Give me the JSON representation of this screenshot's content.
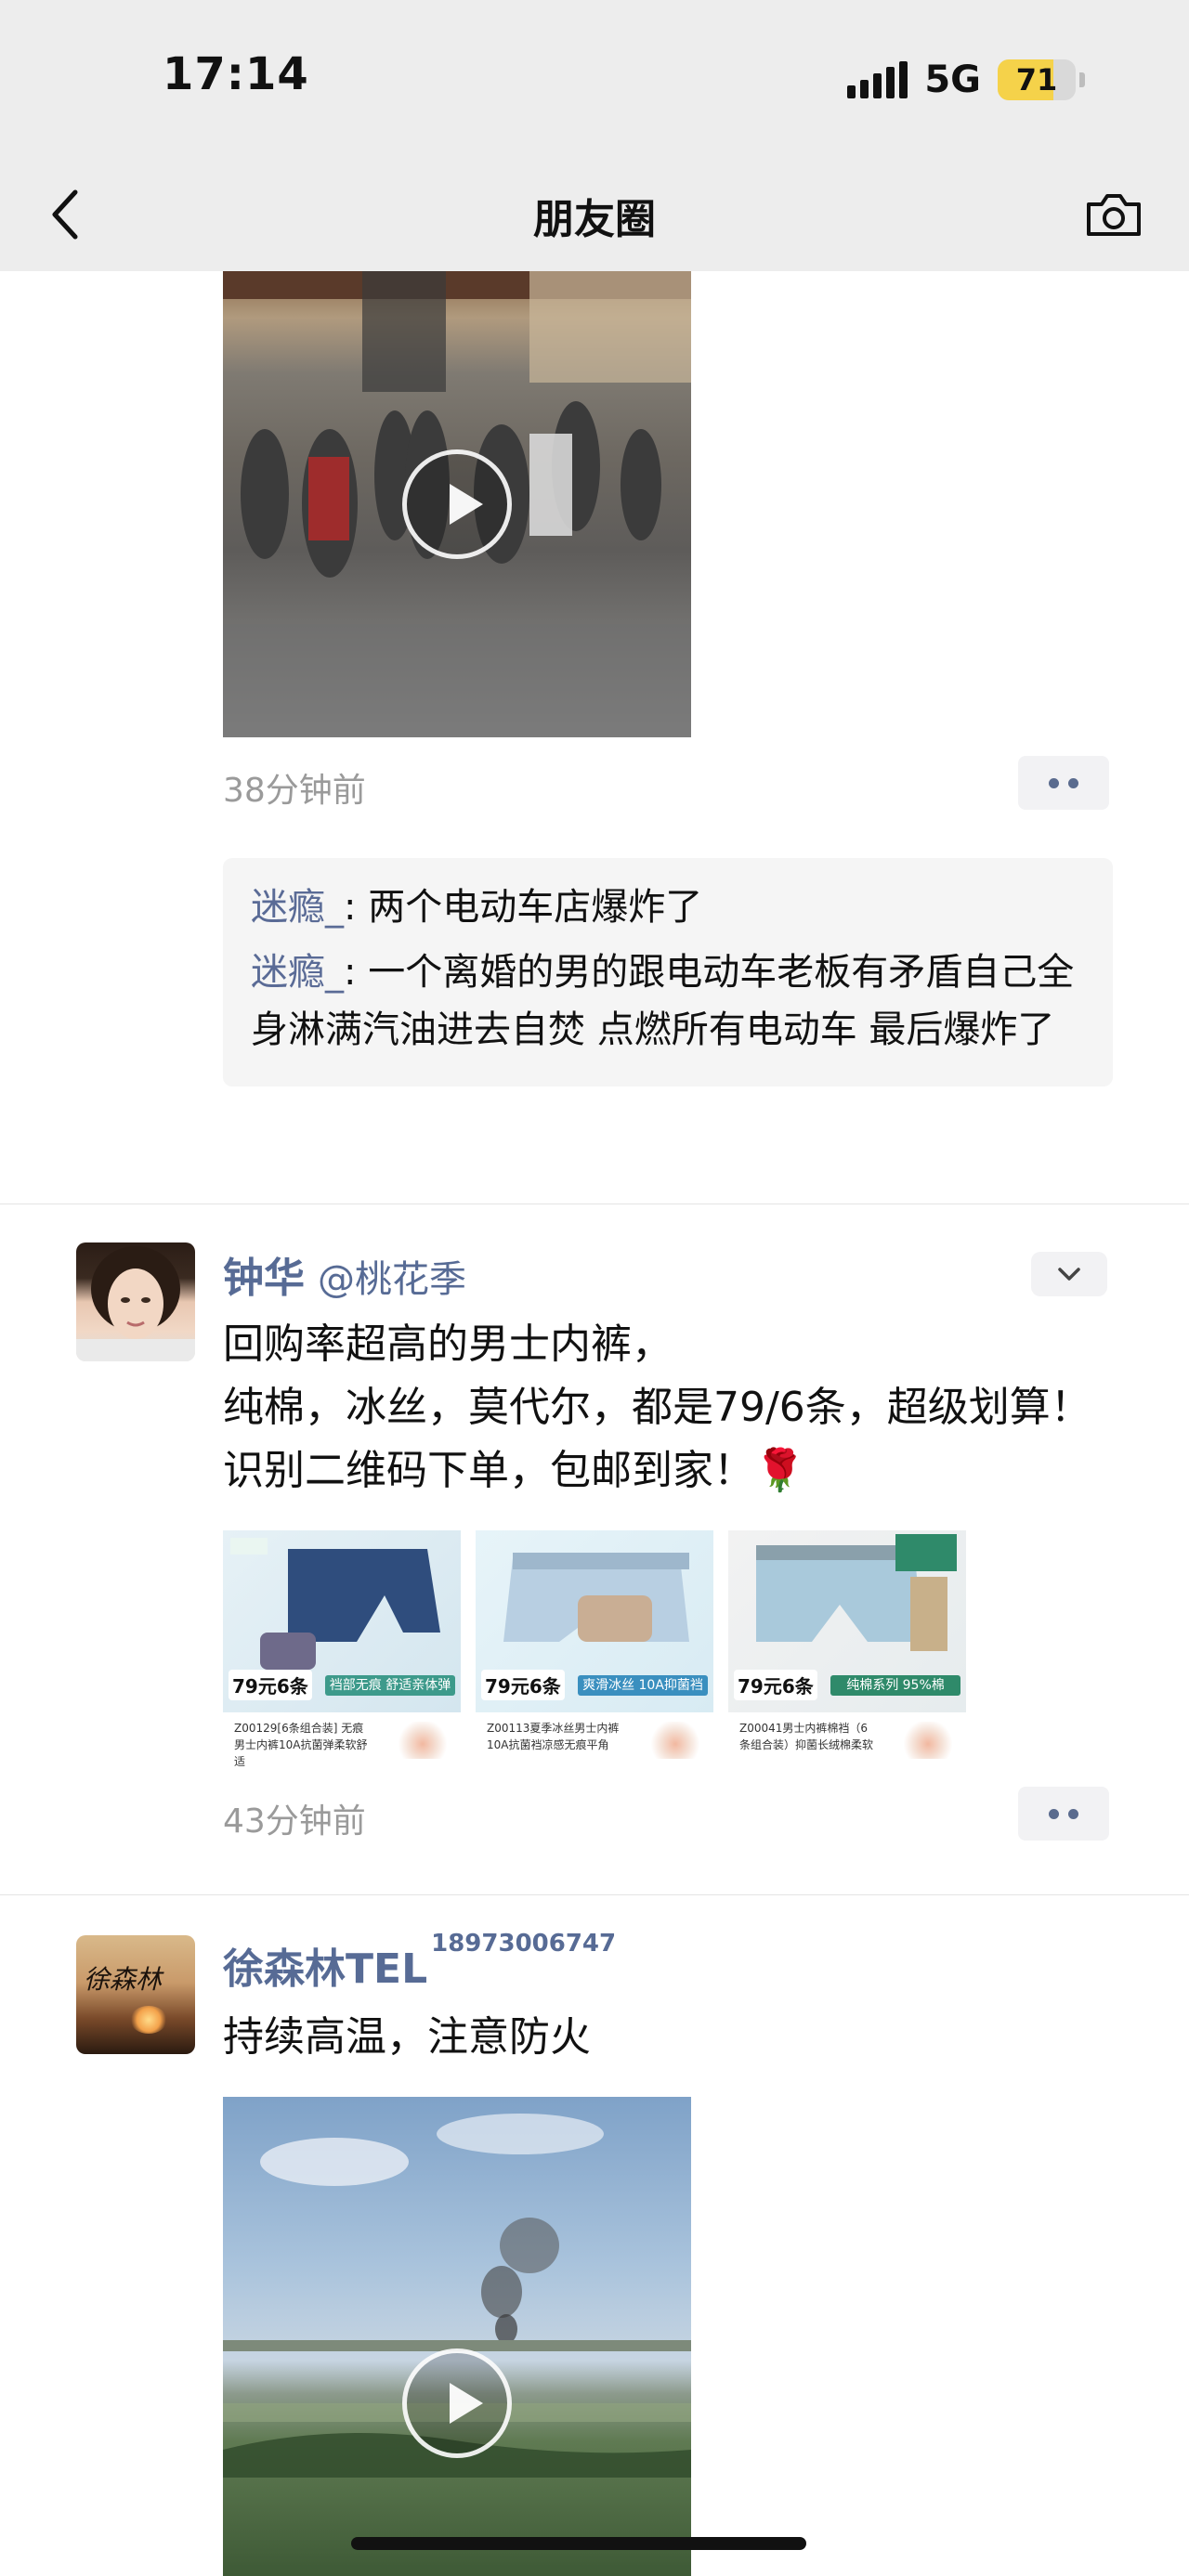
{
  "status_bar": {
    "time": "17:14",
    "network": "5G",
    "battery": "71",
    "battery_level": 0.71
  },
  "nav": {
    "title": "朋友圈",
    "back_icon": "chevron-left-icon",
    "camera_icon": "camera-icon"
  },
  "post1": {
    "time": "38分钟前",
    "comments": [
      {
        "name": "迷瘾_",
        "text": ": 两个电动车店爆炸了"
      },
      {
        "name": "迷瘾_",
        "text": ": 一个离婚的男的跟电动车老板有矛盾自己全身淋满汽油进去自焚 点燃所有电动车 最后爆炸了"
      }
    ]
  },
  "post2": {
    "name": "钟华",
    "mention": "@桃花季",
    "text_line1": "回购率超高的男士内裤，",
    "text_line2": "纯棉，冰丝，莫代尔，都是79/6条，超级划算！识别二维码下单，包邮到家！🌹",
    "time": "43分钟前",
    "thumbs": [
      {
        "badge": "79元6条",
        "tag": "裆部无痕 舒适亲体弹",
        "caption": "Z00129[6条组合装] 无痕男士内裤10A抗菌弹柔软舒适"
      },
      {
        "badge": "79元6条",
        "tag": "爽滑冰丝 10A抑菌裆",
        "caption": "Z00113夏季冰丝男士内裤10A抗菌裆凉感无痕平角"
      },
      {
        "badge": "79元6条",
        "tag": "纯棉系列 95%棉",
        "caption": "Z00041男士内裤棉裆（6条组合装）抑菌长绒棉柔软"
      }
    ]
  },
  "post3": {
    "name": "徐森林TEL",
    "phone": "18973006747",
    "text": "持续高温，注意防火",
    "avatar_text": "徐森林"
  },
  "colors": {
    "link_blue": "#576b95",
    "header_bg": "#ededed",
    "battery_yellow": "#f5d24a"
  }
}
